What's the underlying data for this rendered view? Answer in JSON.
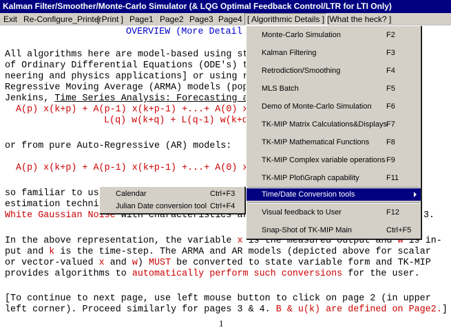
{
  "window": {
    "title": "Kalman Filter/Smoother/Monte-Carlo Simulator (& LQG Optimal Feedback Control/LTR for LTI Only)"
  },
  "menubar": {
    "exit": "Exit",
    "reconfigure": "Re-Configure_Printer",
    "print": "[ Print ]",
    "page1": "Page1",
    "page2": "Page2",
    "page3": "Page3",
    "page4": "Page4",
    "algorithmic": "[ Algorithmic Details ]",
    "whatheck": "[What the heck? ]"
  },
  "document": {
    "heading": "OVERVIEW (More Detail",
    "l1": "All algorithms here are model-based using st",
    "l2": "of Ordinary Differential Equations (ODE's) t",
    "l3": "neering and physics applications] or using r",
    "l4": "Regressive Moving Average (ARMA) models (pop",
    "l5a": "Jenkins, ",
    "l5b": "Time Series Analysis: Forecasting a",
    "eq1": "A(p) x(k+p) + A(p-1) x(k+p-1) +...+ A(0) x",
    "eq2": "L(q) w(k+q) + L(q-1) w(k+q",
    "ar_intro": "or from pure Auto-Regressive (AR) models:",
    "eq3": "A(p) x(k+p) + A(p-1) x(k+p-1) +...+ A(0) x",
    "s1": "so familiar to us",
    "s2": "estimation techni",
    "s3a": "White Gaussian Noise",
    "s3b": " with characteristics ar",
    "s3c": "3.",
    "r1a": "In the above representation, the variable ",
    "r1x": "x",
    "r1b": " is the measured output and ",
    "r1w": "w",
    "r1c": " is in-",
    "r2a": "put and ",
    "r2k": "k",
    "r2b": " is the time-step. The ARMA and AR models (depicted above for scalar",
    "r3a": "or vector-valued ",
    "r3x": "x",
    "r3and": " and ",
    "r3w": "w",
    "r3b": ") ",
    "r3must": "MUST",
    "r3c": " be converted to state variable form and TK-MIP",
    "r4a": "provides algorithms to ",
    "r4red": "automatically perform such conversions",
    "r4b": " for the user.",
    "c1": "[To continue to next page, use left mouse button to click on page 2 (in upper",
    "c2a": "left corner). Proceed similarly for pages 3 & 4. ",
    "c2red": "B & u(k) are defined on Page2.",
    "c2b": "]",
    "page_number": "1"
  },
  "algorithmic_menu": [
    {
      "label": "Monte-Carlo Simulation",
      "shortcut": "F2"
    },
    {
      "label": "Kalman Filtering",
      "shortcut": "F3"
    },
    {
      "label": "Retrodiction/Smoothing",
      "shortcut": "F4"
    },
    {
      "label": "MLS Batch",
      "shortcut": "F5"
    },
    {
      "label": "Demo of Monte-Carlo Simulation",
      "shortcut": "F6"
    },
    {
      "label": "TK-MIP Matrix Calculations&Displays",
      "shortcut": "F7"
    },
    {
      "label": "TK-MIP Mathematical Functions",
      "shortcut": "F8"
    },
    {
      "label": "TK-MIP Complex variable operations",
      "shortcut": "F9"
    },
    {
      "label": "TK-MIP Plot\\Graph capability",
      "shortcut": "F11"
    },
    {
      "label": "Time/Date Conversion tools",
      "shortcut": ""
    },
    {
      "label": "Visual feedback to User",
      "shortcut": "F12"
    },
    {
      "label": "Snap-Shot of TK-MIP Main",
      "shortcut": "Ctrl+F5"
    }
  ],
  "time_date_submenu": [
    {
      "label": "Calendar",
      "shortcut": "Ctrl+F3"
    },
    {
      "label": "Julian Date conversion tool",
      "shortcut": "Ctrl+F4"
    }
  ],
  "colors": {
    "titlebar": "#000080",
    "highlight": "#000080",
    "menu_face": "#d4d0c8",
    "emphasis_red": "#cc0000",
    "heading_blue": "#0000cc"
  }
}
